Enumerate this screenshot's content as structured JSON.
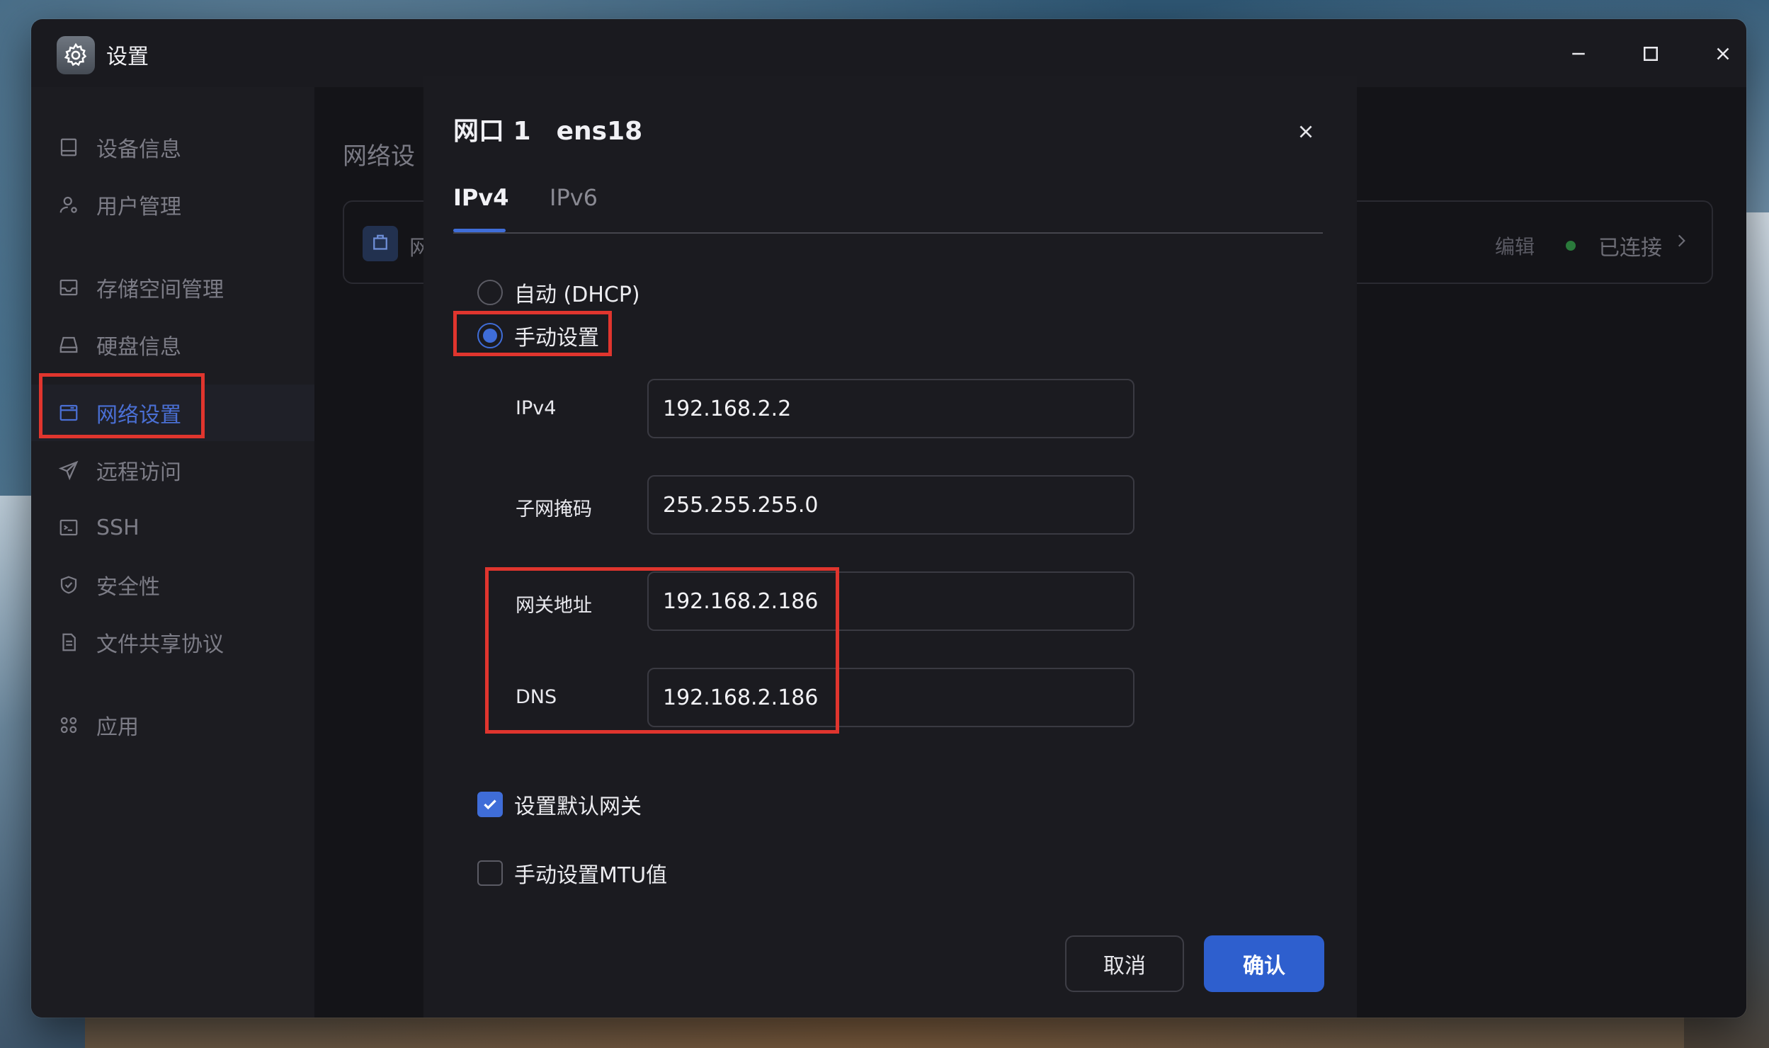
{
  "window": {
    "title": "设置",
    "app_icon": "gear-icon"
  },
  "sidebar": {
    "items": [
      {
        "label": "设备信息",
        "icon": "device-info-icon"
      },
      {
        "label": "用户管理",
        "icon": "user-icon"
      },
      {
        "label": "存储空间管理",
        "icon": "storage-icon"
      },
      {
        "label": "硬盘信息",
        "icon": "disk-icon"
      },
      {
        "label": "网络设置",
        "icon": "network-icon",
        "active": true
      },
      {
        "label": "远程访问",
        "icon": "send-icon"
      },
      {
        "label": "SSH",
        "icon": "terminal-icon"
      },
      {
        "label": "安全性",
        "icon": "shield-icon"
      },
      {
        "label": "文件共享协议",
        "icon": "file-icon"
      },
      {
        "label": "应用",
        "icon": "apps-icon"
      }
    ]
  },
  "main": {
    "title": "网络设",
    "card": {
      "label_partial": "网",
      "edit": "编辑",
      "status": "已连接"
    }
  },
  "dialog": {
    "title": "网口 1",
    "subtitle": "ens18",
    "tabs": [
      "IPv4",
      "IPv6"
    ],
    "active_tab": "IPv4",
    "radio_auto": "自动 (DHCP)",
    "radio_manual": "手动设置",
    "selected_mode": "手动设置",
    "fields": {
      "ipv4": {
        "label": "IPv4",
        "value": "192.168.2.2"
      },
      "subnet": {
        "label": "子网掩码",
        "value": "255.255.255.0"
      },
      "gateway": {
        "label": "网关地址",
        "value": "192.168.2.186"
      },
      "dns": {
        "label": "DNS",
        "value": "192.168.2.186"
      }
    },
    "check_default_gateway": {
      "label": "设置默认网关",
      "checked": true
    },
    "check_mtu": {
      "label": "手动设置MTU值",
      "checked": false
    },
    "cancel": "取消",
    "confirm": "确认"
  },
  "colors": {
    "accent": "#3f6dd8",
    "highlight": "#e0352e",
    "connected": "#2a7a3b"
  }
}
